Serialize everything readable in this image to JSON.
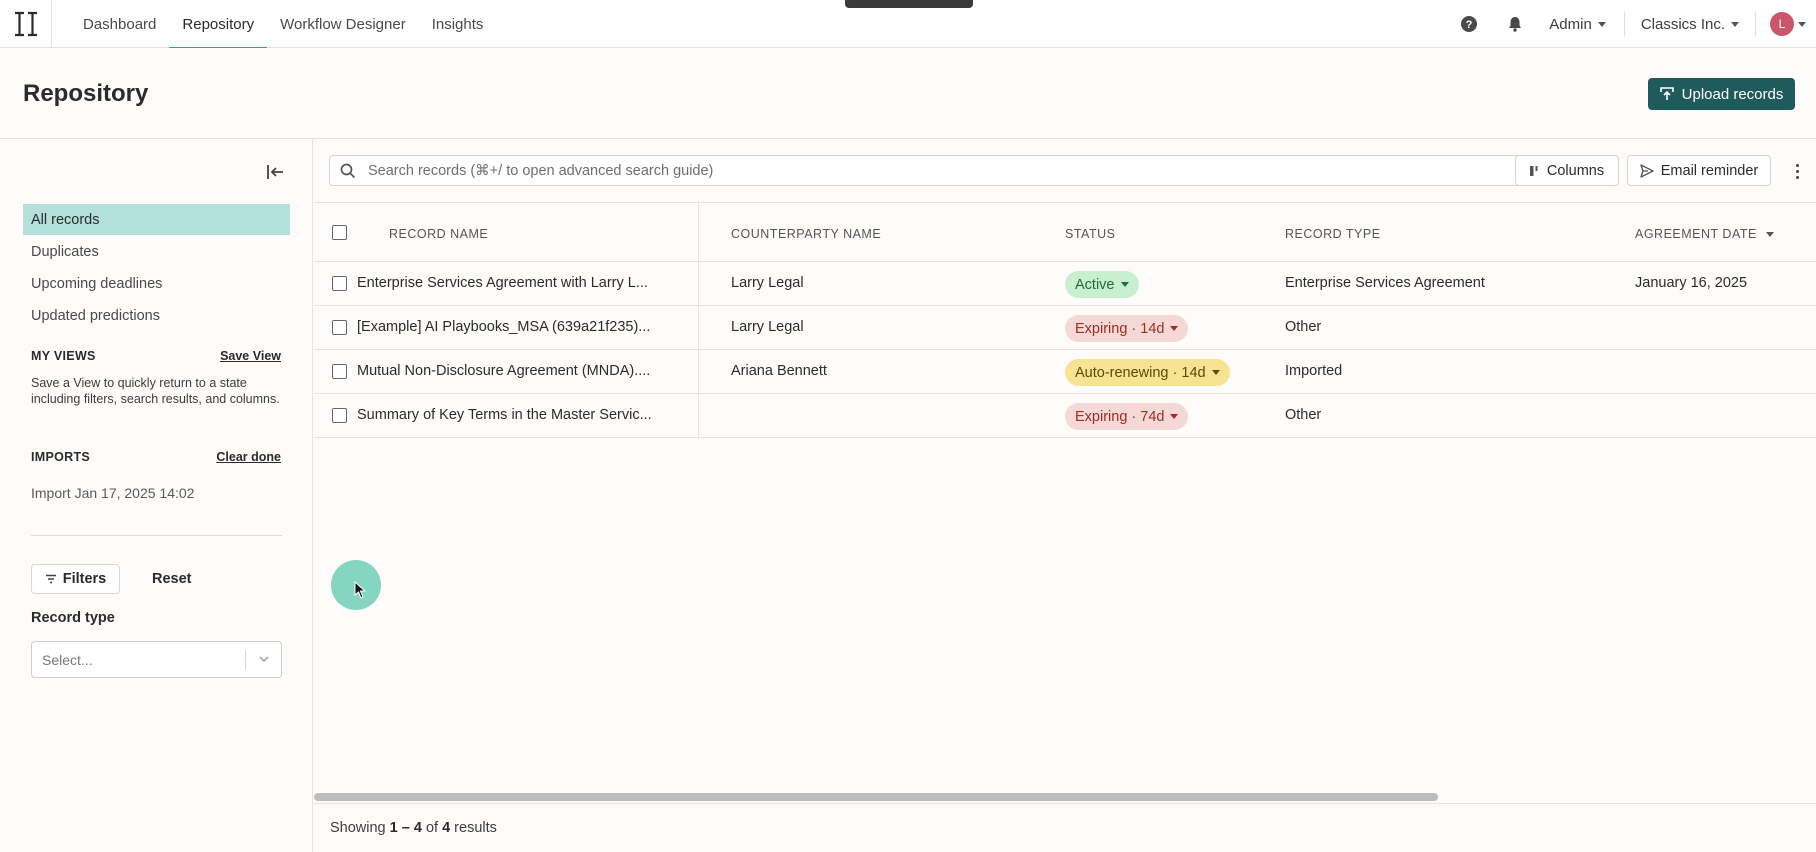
{
  "nav": {
    "tabs": [
      {
        "label": "Dashboard"
      },
      {
        "label": "Repository"
      },
      {
        "label": "Workflow Designer"
      },
      {
        "label": "Insights"
      }
    ],
    "active_tab": "Repository",
    "admin_label": "Admin",
    "org_label": "Classics Inc.",
    "avatar_initial": "L",
    "icons": [
      "logo-icon",
      "help-icon",
      "bell-icon"
    ]
  },
  "header": {
    "title": "Repository",
    "upload_label": "Upload records"
  },
  "sidebar": {
    "links": [
      {
        "label": "All records"
      },
      {
        "label": "Duplicates"
      },
      {
        "label": "Upcoming deadlines"
      },
      {
        "label": "Updated predictions"
      }
    ],
    "my_views_label": "MY VIEWS",
    "save_view_label": "Save View",
    "my_views_hint": "Save a View to quickly return to a state including filters, search results, and columns.",
    "imports_label": "IMPORTS",
    "clear_done_label": "Clear done",
    "import_item": "Import Jan 17, 2025 14:02",
    "filters_label": "Filters",
    "reset_label": "Reset",
    "record_type_label": "Record type",
    "record_type_placeholder": "Select..."
  },
  "toolbar": {
    "search_placeholder": "Search records (⌘+/ to open advanced search guide)",
    "columns_label": "Columns",
    "email_reminder_label": "Email reminder"
  },
  "table": {
    "headers": {
      "record_name": "RECORD NAME",
      "counterparty": "COUNTERPARTY NAME",
      "status": "STATUS",
      "record_type": "RECORD TYPE",
      "agreement_date": "AGREEMENT DATE"
    },
    "rows": [
      {
        "name": "Enterprise Services Agreement with Larry L...",
        "counterparty": "Larry Legal",
        "status": "Active",
        "record_type": "Enterprise Services Agreement",
        "agreement_date": "January 16, 2025"
      },
      {
        "name": "[Example] AI Playbooks_MSA (639a21f235)...",
        "counterparty": "Larry Legal",
        "status": "Expiring · 14d",
        "record_type": "Other",
        "agreement_date": ""
      },
      {
        "name": "Mutual Non-Disclosure Agreement (MNDA)....",
        "counterparty": "Ariana Bennett",
        "status": "Auto-renewing · 14d",
        "record_type": "Imported",
        "agreement_date": ""
      },
      {
        "name": "Summary of Key Terms in the Master Servic...",
        "counterparty": "",
        "status": "Expiring · 74d",
        "record_type": "Other",
        "agreement_date": ""
      }
    ],
    "status_colors": {
      "active": {
        "bg": "#c8efcf",
        "fg": "#1f6b34"
      },
      "expiring": {
        "bg": "#f6d9d6",
        "fg": "#9b2e25"
      },
      "auto_renewing": {
        "bg": "#f7e392",
        "fg": "#5e4a05"
      }
    }
  },
  "footer": {
    "prefix": "Showing",
    "range": "1 – 4",
    "of": "of",
    "total": "4",
    "suffix": "results"
  },
  "colors": {
    "accent": "#2fa39a",
    "primary_button": "#1f5a5c",
    "active_sidebar": "#b4e0dc"
  }
}
